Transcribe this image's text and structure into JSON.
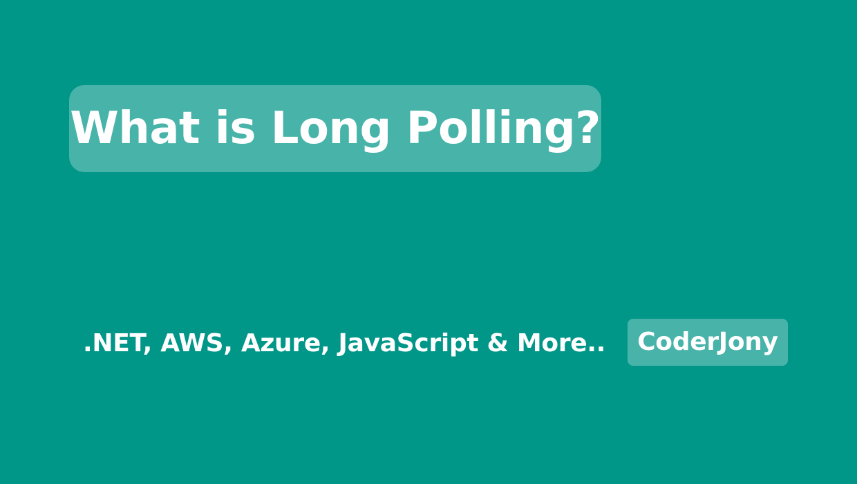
{
  "banner": {
    "title": "What is Long Polling?",
    "tagline": ".NET, AWS, Azure, JavaScript & More..",
    "brand": "CoderJony"
  },
  "colors": {
    "background": "#009688",
    "text": "#ffffff",
    "pill_overlay": "rgba(255,255,255,0.28)"
  }
}
